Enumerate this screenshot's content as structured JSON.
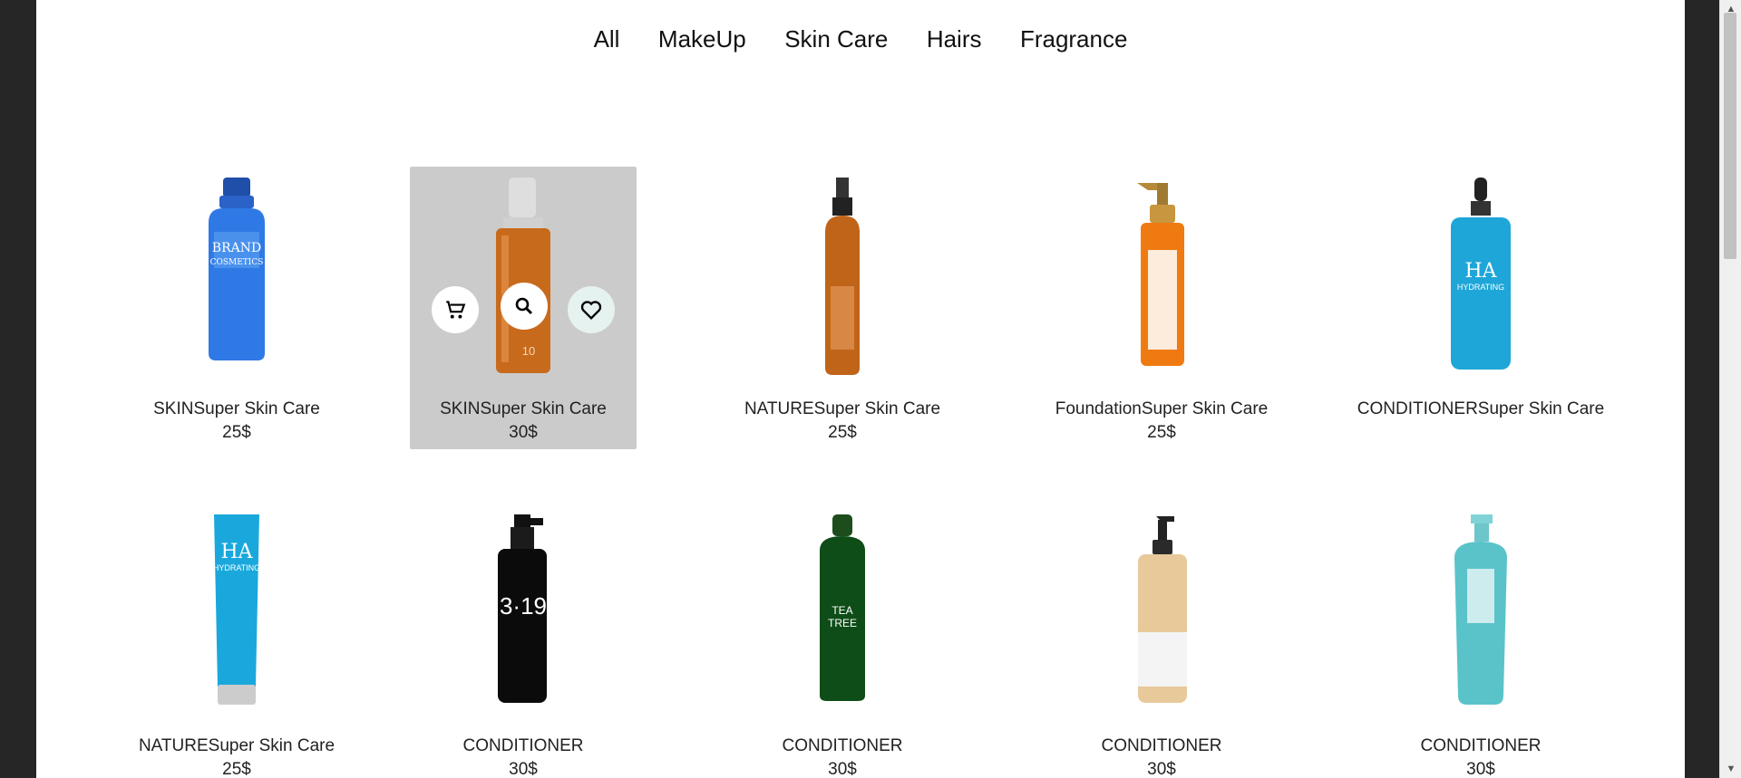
{
  "nav": {
    "items": [
      "All",
      "MakeUp",
      "Skin Care",
      "Hairs",
      "Fragrance"
    ]
  },
  "products": [
    {
      "name": "SKINSuper Skin Care",
      "price": "25$"
    },
    {
      "name": "SKINSuper Skin Care",
      "price": "30$"
    },
    {
      "name": "NATURESuper Skin Care",
      "price": "25$"
    },
    {
      "name": "FoundationSuper Skin Care",
      "price": "25$"
    },
    {
      "name": "CONDITIONERSuper Skin Care",
      "price": ""
    },
    {
      "name": "NATURESuper Skin Care",
      "price": "25$"
    },
    {
      "name": "CONDITIONER",
      "price": "30$"
    },
    {
      "name": "CONDITIONER",
      "price": "30$"
    },
    {
      "name": "CONDITIONER",
      "price": "30$"
    },
    {
      "name": "CONDITIONER",
      "price": "30$"
    }
  ],
  "hover_actions": {
    "cart_icon": "cart-icon",
    "search_icon": "search-icon",
    "wishlist_icon": "heart-icon"
  },
  "colors": {
    "hover_bg": "#cbcbcb",
    "page_bg": "#ffffff",
    "outer_bg": "#262626"
  }
}
